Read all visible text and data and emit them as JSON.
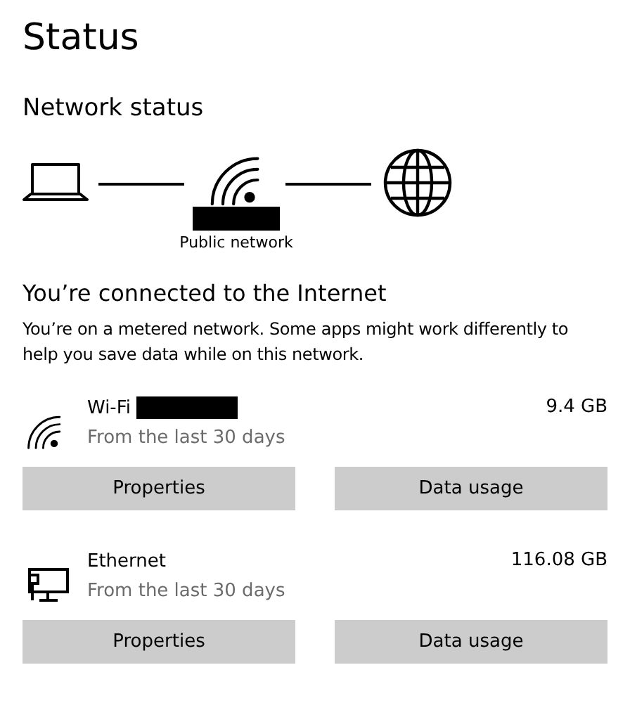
{
  "title": "Status",
  "section": "Network status",
  "diagram": {
    "network_label": "Public network",
    "network_name_redacted": true
  },
  "connection": {
    "heading": "You’re connected to the Internet",
    "message": "You’re on a metered network. Some apps might work differently to help you save data while on this network."
  },
  "adapters": [
    {
      "kind": "wifi",
      "name": "Wi-Fi",
      "name_redacted": true,
      "period": "From the last 30 days",
      "amount": "9.4 GB",
      "buttons": [
        "Properties",
        "Data usage"
      ]
    },
    {
      "kind": "ethernet",
      "name": "Ethernet",
      "name_redacted": false,
      "period": "From the last 30 days",
      "amount": "116.08 GB",
      "buttons": [
        "Properties",
        "Data usage"
      ]
    }
  ]
}
